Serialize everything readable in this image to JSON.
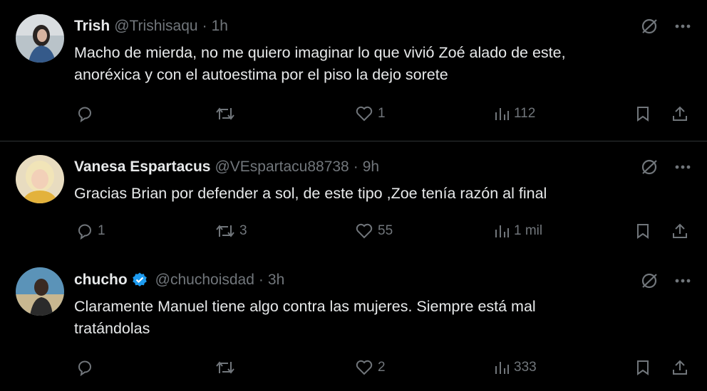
{
  "colors": {
    "background": "#000000",
    "text": "#e7e9ea",
    "muted": "#71767b",
    "verified": "#1d9bf0",
    "divider": "#2f3336"
  },
  "tweets": [
    {
      "name": "Trish",
      "handle": "@Trishisaqu",
      "separator": "·",
      "time": "1h",
      "text_lines": [
        "Macho de mierda, no me quiero imaginar lo que vivió Zoé alado de este,",
        "anoréxica y con el autoestima por el piso la dejo sorete"
      ],
      "replies": "",
      "retweets": "",
      "likes": "1",
      "views": "112"
    },
    {
      "name": "Vanesa Espartacus",
      "handle": "@VEspartacu88738",
      "separator": "·",
      "time": "9h",
      "text_lines": [
        "Gracias Brian por defender a sol, de este tipo ,Zoe tenía razón al final"
      ],
      "replies": "1",
      "retweets": "3",
      "likes": "55",
      "views": "1 mil"
    },
    {
      "name": "chucho",
      "verified": true,
      "handle": "@chuchoisdad",
      "separator": "·",
      "time": "3h",
      "text_lines": [
        "Claramente Manuel tiene algo contra las mujeres. Siempre está mal",
        "tratándolas"
      ],
      "replies": "",
      "retweets": "",
      "likes": "2",
      "views": "333"
    }
  ]
}
